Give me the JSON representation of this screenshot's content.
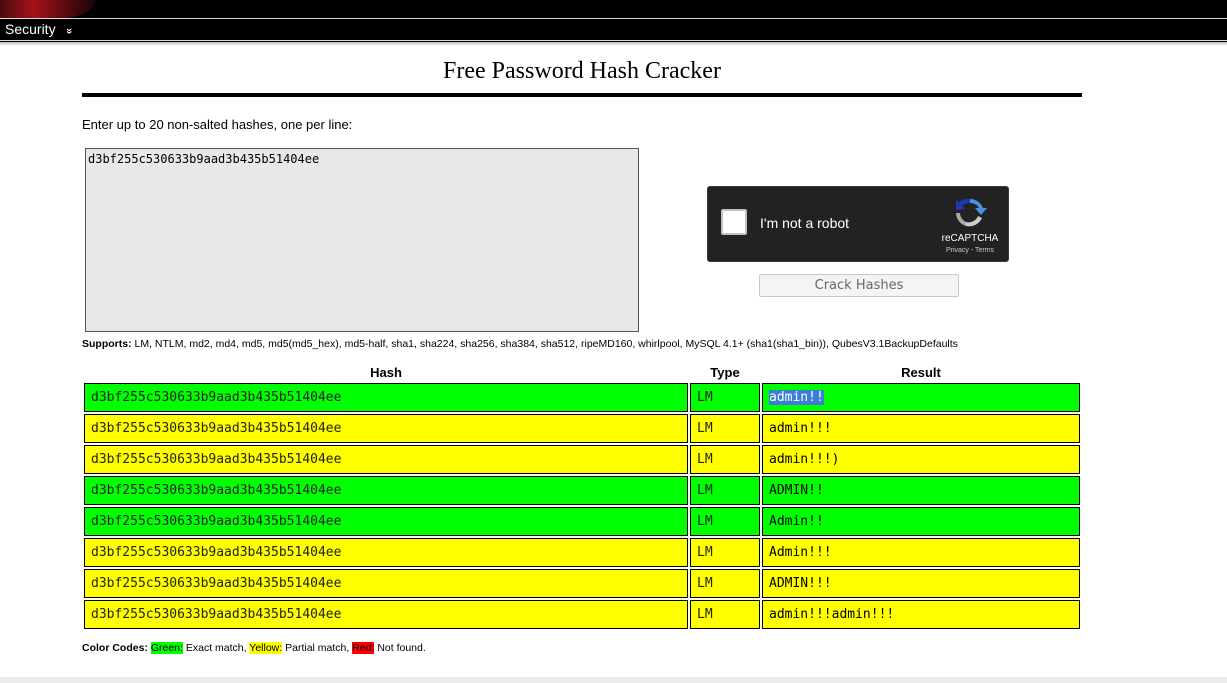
{
  "nav": {
    "security_label": "Security",
    "chevron_glyph": "»"
  },
  "page": {
    "title": "Free Password Hash Cracker",
    "instructions": "Enter up to 20 non-salted hashes, one per line:",
    "input_value": "d3bf255c530633b9aad3b435b51404ee"
  },
  "recaptcha": {
    "label": "I'm not a robot",
    "brand": "reCAPTCHA",
    "links": "Privacy - Terms"
  },
  "crack_button_label": "Crack Hashes",
  "supports": {
    "label": "Supports:",
    "list": "LM, NTLM, md2, md4, md5, md5(md5_hex), md5-half, sha1, sha224, sha256, sha384, sha512, ripeMD160, whirlpool, MySQL 4.1+ (sha1(sha1_bin)), QubesV3.1BackupDefaults"
  },
  "results": {
    "headers": {
      "hash": "Hash",
      "type": "Type",
      "result": "Result"
    },
    "rows": [
      {
        "hash": "d3bf255c530633b9aad3b435b51404ee",
        "type": "LM",
        "result": "admin!!",
        "status": "green"
      },
      {
        "hash": "d3bf255c530633b9aad3b435b51404ee",
        "type": "LM",
        "result": "admin!!!",
        "status": "yellow"
      },
      {
        "hash": "d3bf255c530633b9aad3b435b51404ee",
        "type": "LM",
        "result": "admin!!!)",
        "status": "yellow"
      },
      {
        "hash": "d3bf255c530633b9aad3b435b51404ee",
        "type": "LM",
        "result": "ADMIN!!",
        "status": "green"
      },
      {
        "hash": "d3bf255c530633b9aad3b435b51404ee",
        "type": "LM",
        "result": "Admin!!",
        "status": "green"
      },
      {
        "hash": "d3bf255c530633b9aad3b435b51404ee",
        "type": "LM",
        "result": "Admin!!!",
        "status": "yellow"
      },
      {
        "hash": "d3bf255c530633b9aad3b435b51404ee",
        "type": "LM",
        "result": "ADMIN!!!",
        "status": "yellow"
      },
      {
        "hash": "d3bf255c530633b9aad3b435b51404ee",
        "type": "LM",
        "result": "admin!!!admin!!!",
        "status": "yellow"
      }
    ]
  },
  "color_codes": {
    "label": "Color Codes:",
    "green": "Green:",
    "green_desc": " Exact match, ",
    "yellow": "Yellow:",
    "yellow_desc": " Partial match, ",
    "red": "Red:",
    "red_desc": " Not found."
  },
  "colors": {
    "exact": "#00ff00",
    "partial": "#ffff00",
    "not_found": "#ff0000"
  }
}
